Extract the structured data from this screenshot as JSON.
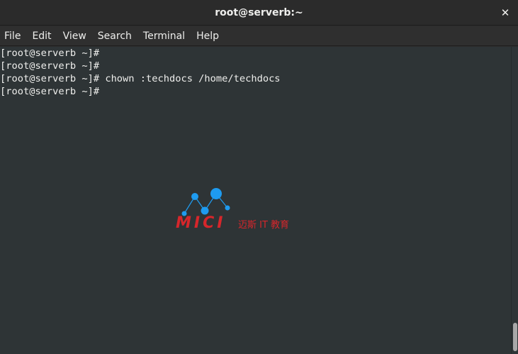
{
  "window": {
    "title": "root@serverb:~",
    "close_label": "✕"
  },
  "menubar": {
    "items": [
      "File",
      "Edit",
      "View",
      "Search",
      "Terminal",
      "Help"
    ]
  },
  "terminal": {
    "lines": [
      "[root@serverb ~]#",
      "[root@serverb ~]#",
      "[root@serverb ~]# chown :techdocs /home/techdocs",
      "[root@serverb ~]#"
    ]
  },
  "watermark": {
    "logo_text": "MICI",
    "caption": "迈斯 IT 教育",
    "brand_color": "#d6262b",
    "node_color": "#1e9bf0"
  },
  "colors": {
    "terminal_bg": "#2e3436",
    "text": "#eeeeec"
  }
}
